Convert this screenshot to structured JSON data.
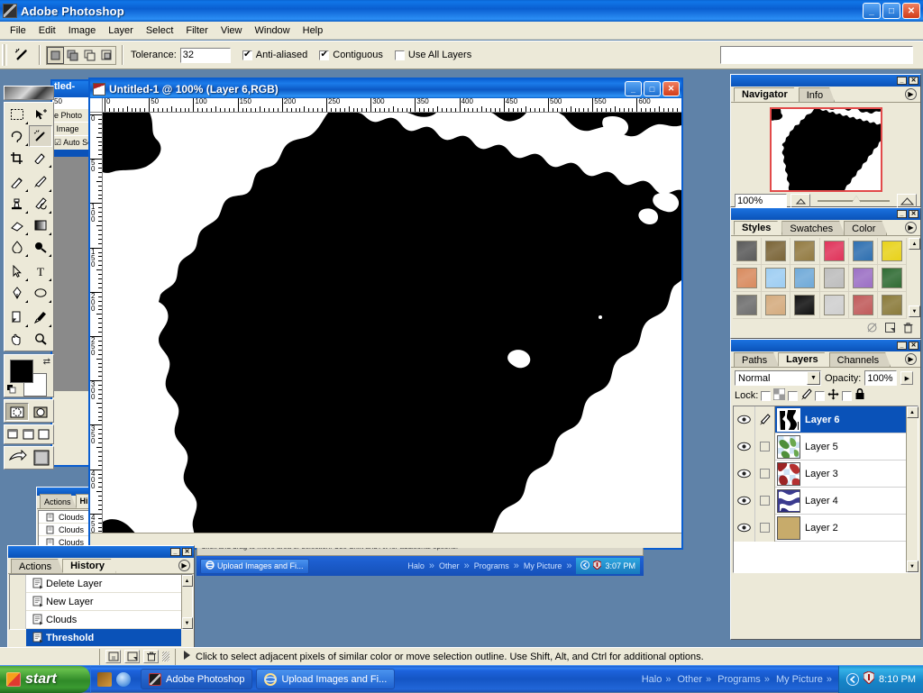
{
  "app": {
    "title": "Adobe Photoshop",
    "window_buttons": [
      "_",
      "□",
      "✕"
    ],
    "menu": [
      "File",
      "Edit",
      "Image",
      "Layer",
      "Select",
      "Filter",
      "View",
      "Window",
      "Help"
    ]
  },
  "options_bar": {
    "tool_icon": "magic-wand-icon",
    "selection_modes": [
      "new-selection",
      "add-to-selection",
      "subtract-from-selection",
      "intersect-selection"
    ],
    "tolerance_label": "Tolerance:",
    "tolerance_value": "32",
    "anti_aliased_label": "Anti-aliased",
    "anti_aliased_checked": "✔",
    "contiguous_label": "Contiguous",
    "contiguous_checked": "✔",
    "use_all_layers_label": "Use All Layers",
    "use_all_layers_checked": ""
  },
  "toolbox": {
    "tools": [
      [
        "marquee-tool",
        "move-tool"
      ],
      [
        "lasso-tool",
        "magic-wand-tool"
      ],
      [
        "crop-tool",
        "slice-tool"
      ],
      [
        "healing-brush-tool",
        "brush-tool"
      ],
      [
        "clone-stamp-tool",
        "history-brush-tool"
      ],
      [
        "eraser-tool",
        "gradient-tool"
      ],
      [
        "blur-tool",
        "dodge-tool"
      ],
      [
        "path-selection-tool",
        "type-tool"
      ],
      [
        "pen-tool",
        "shape-tool"
      ],
      [
        "notes-tool",
        "eyedropper-tool"
      ],
      [
        "hand-tool",
        "zoom-tool"
      ]
    ],
    "foreground_color": "#000000",
    "background_color": "#ffffff",
    "quick_mask_modes": [
      "standard-mode",
      "quick-mask-mode"
    ],
    "screen_modes": [
      "standard-screen-mode",
      "full-screen-with-menubar",
      "full-screen-mode"
    ],
    "jump_to_label": "jump-to-imageready"
  },
  "document": {
    "title": "Untitled-1 @ 100% (Layer 6,RGB)",
    "zoom": "100%",
    "color_mode": "RGB",
    "active_layer": "Layer 6",
    "window_buttons": [
      "_",
      "□",
      "✕"
    ],
    "h_ruler_ticks": [
      "0",
      "50",
      "100",
      "150",
      "200",
      "250",
      "300",
      "350",
      "400",
      "450",
      "500",
      "550",
      "600"
    ],
    "v_ruler_ticks": [
      "0",
      "50",
      "100",
      "150",
      "200",
      "250",
      "300",
      "350",
      "400",
      "450"
    ],
    "ruler_unit": "pixels"
  },
  "navigator": {
    "tabs": [
      "Navigator",
      "Info"
    ],
    "active_tab": "Navigator",
    "zoom_value": "100%",
    "thumb_border_color": "#e24a4a"
  },
  "styles": {
    "tabs": [
      "Styles",
      "Swatches",
      "Color"
    ],
    "active_tab": "Styles",
    "swatch_colors": [
      "#5a5a5a",
      "#7a6437",
      "#927a41",
      "#e0335a",
      "#2e6fb0",
      "#e8d21a",
      "#d88a5e",
      "#9dcdf2",
      "#6fa9d8",
      "#bdbdbd",
      "#9b6fc4",
      "#2f6b33",
      "#6e6e6e",
      "#d4ab7e",
      "#111111",
      "#cfcfcf",
      "#c05a5a",
      "#8a7a3a"
    ],
    "footer_buttons": [
      "clear-style-button",
      "new-style-button",
      "delete-style-button"
    ]
  },
  "layers": {
    "tabs": [
      "Paths",
      "Layers",
      "Channels"
    ],
    "active_tab": "Layers",
    "blend_mode": "Normal",
    "opacity_label": "Opacity:",
    "opacity_value": "100%",
    "lock_label": "Lock:",
    "lock_options": [
      "lock-transparent-pixels",
      "lock-image-pixels",
      "lock-position",
      "lock-all"
    ],
    "rows": [
      {
        "name": "Layer 6",
        "selected": true,
        "visible": "✔",
        "linked": true,
        "thumb": "threshold-clouds-thumb"
      },
      {
        "name": "Layer 5",
        "selected": false,
        "visible": "✔",
        "linked": false,
        "thumb": "green-splatter-thumb"
      },
      {
        "name": "Layer 3",
        "selected": false,
        "visible": "✔",
        "linked": false,
        "thumb": "red-splatter-thumb"
      },
      {
        "name": "Layer 4",
        "selected": false,
        "visible": "✔",
        "linked": false,
        "thumb": "blue-splatter-thumb"
      },
      {
        "name": "Layer 2",
        "selected": false,
        "visible": "✔",
        "linked": false,
        "thumb": "tan-fill-thumb"
      }
    ],
    "footer_buttons": [
      "layer-style-button",
      "layer-mask-button",
      "new-group-button",
      "adjustment-layer-button",
      "new-layer-button",
      "delete-layer-button"
    ]
  },
  "history": {
    "tabs": [
      "Actions",
      "History"
    ],
    "active_tab": "History",
    "items": [
      {
        "label": "Delete Layer",
        "selected": false
      },
      {
        "label": "New Layer",
        "selected": false
      },
      {
        "label": "Clouds",
        "selected": false
      },
      {
        "label": "Threshold",
        "selected": true
      }
    ],
    "footer_buttons": [
      "new-document-from-state",
      "new-snapshot",
      "delete-state"
    ]
  },
  "back_palette": {
    "tabs": [
      "Actions",
      "History"
    ],
    "items": [
      "Clouds",
      "Clouds",
      "Clouds"
    ]
  },
  "status_bar": {
    "hint": "Click to select adjacent pixels of similar color or move selection outline.  Use Shift, Alt, and Ctrl for additional options.",
    "buttons": [
      "new-doc-button",
      "snapshot-button",
      "trash-button"
    ]
  },
  "inner_screenshot": {
    "hint": "Click and drag to move area or selection.  Use Shift and Alt for additional options.",
    "taskbar_button": "Upload Images and Fi...",
    "toolbars": [
      "Halo",
      "Other",
      "Programs",
      "My Picture"
    ],
    "clock": "3:07 PM"
  },
  "taskbar": {
    "start_label": "start",
    "quick_launch": [
      "media-player-icon",
      "internet-icon"
    ],
    "buttons": [
      {
        "label": "Adobe Photoshop",
        "icon": "photoshop-icon",
        "active": true
      },
      {
        "label": "Upload Images and Fi...",
        "icon": "internet-explorer-icon",
        "active": false
      }
    ],
    "toolbars": [
      "Halo",
      "Other",
      "Programs",
      "My Picture"
    ],
    "tray_icons": [
      "show-desktop-icon",
      "antivirus-icon"
    ],
    "clock": "8:10 PM"
  },
  "colors": {
    "titlebar_blue": "#0a5ed0",
    "panel_face": "#ece9d8",
    "selection_blue": "#0a52b8",
    "desktop": "#5b7a9e"
  },
  "chart_data": null
}
